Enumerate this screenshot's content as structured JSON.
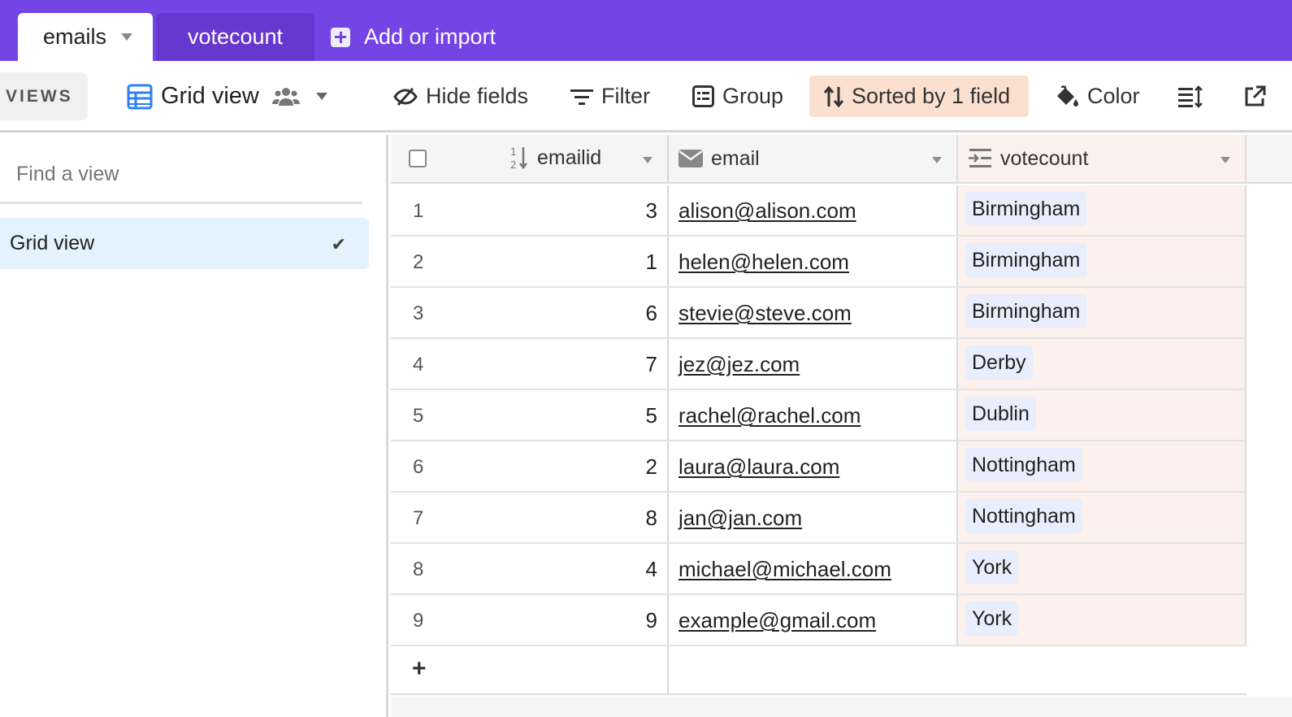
{
  "colors": {
    "brand_purple": "#7544e4",
    "sort_highlight": "#fbe0d0",
    "selected_view_bg": "#e3f2fd",
    "vote_column_bg": "#fcf1ec",
    "pill_bg": "#e8eefb",
    "grid_icon_blue": "#2d7ff9"
  },
  "tabs": {
    "active": "emails",
    "inactive": "votecount",
    "add_label": "Add or import"
  },
  "toolbar": {
    "views_label": "VIEWS",
    "view_name": "Grid view",
    "hide_fields": "Hide fields",
    "filter": "Filter",
    "group": "Group",
    "sorted": "Sorted by 1 field",
    "color": "Color",
    "icons": [
      "grid-view-icon",
      "users-icon",
      "hide-fields-icon",
      "filter-icon",
      "group-icon",
      "sort-icon",
      "paint-bucket-icon",
      "row-height-icon",
      "share-view-icon"
    ]
  },
  "sidebar": {
    "find_placeholder": "Find a view",
    "views": [
      {
        "label": "Grid view",
        "check": "✔"
      }
    ]
  },
  "grid": {
    "columns": [
      {
        "label": "emailid",
        "icon": "number-sort-icon"
      },
      {
        "label": "email",
        "icon": "envelope-icon"
      },
      {
        "label": "votecount",
        "icon": "lookup-icon"
      }
    ],
    "rows": [
      {
        "num": "1",
        "emailid": "3",
        "email": "alison@alison.com",
        "votecount": "Birmingham"
      },
      {
        "num": "2",
        "emailid": "1",
        "email": "helen@helen.com",
        "votecount": "Birmingham"
      },
      {
        "num": "3",
        "emailid": "6",
        "email": "stevie@steve.com",
        "votecount": "Birmingham"
      },
      {
        "num": "4",
        "emailid": "7",
        "email": "jez@jez.com",
        "votecount": "Derby"
      },
      {
        "num": "5",
        "emailid": "5",
        "email": "rachel@rachel.com",
        "votecount": "Dublin"
      },
      {
        "num": "6",
        "emailid": "2",
        "email": "laura@laura.com",
        "votecount": "Nottingham"
      },
      {
        "num": "7",
        "emailid": "8",
        "email": "jan@jan.com",
        "votecount": "Nottingham"
      },
      {
        "num": "8",
        "emailid": "4",
        "email": "michael@michael.com",
        "votecount": "York"
      },
      {
        "num": "9",
        "emailid": "9",
        "email": "example@gmail.com",
        "votecount": "York"
      }
    ],
    "add_row": "+"
  }
}
